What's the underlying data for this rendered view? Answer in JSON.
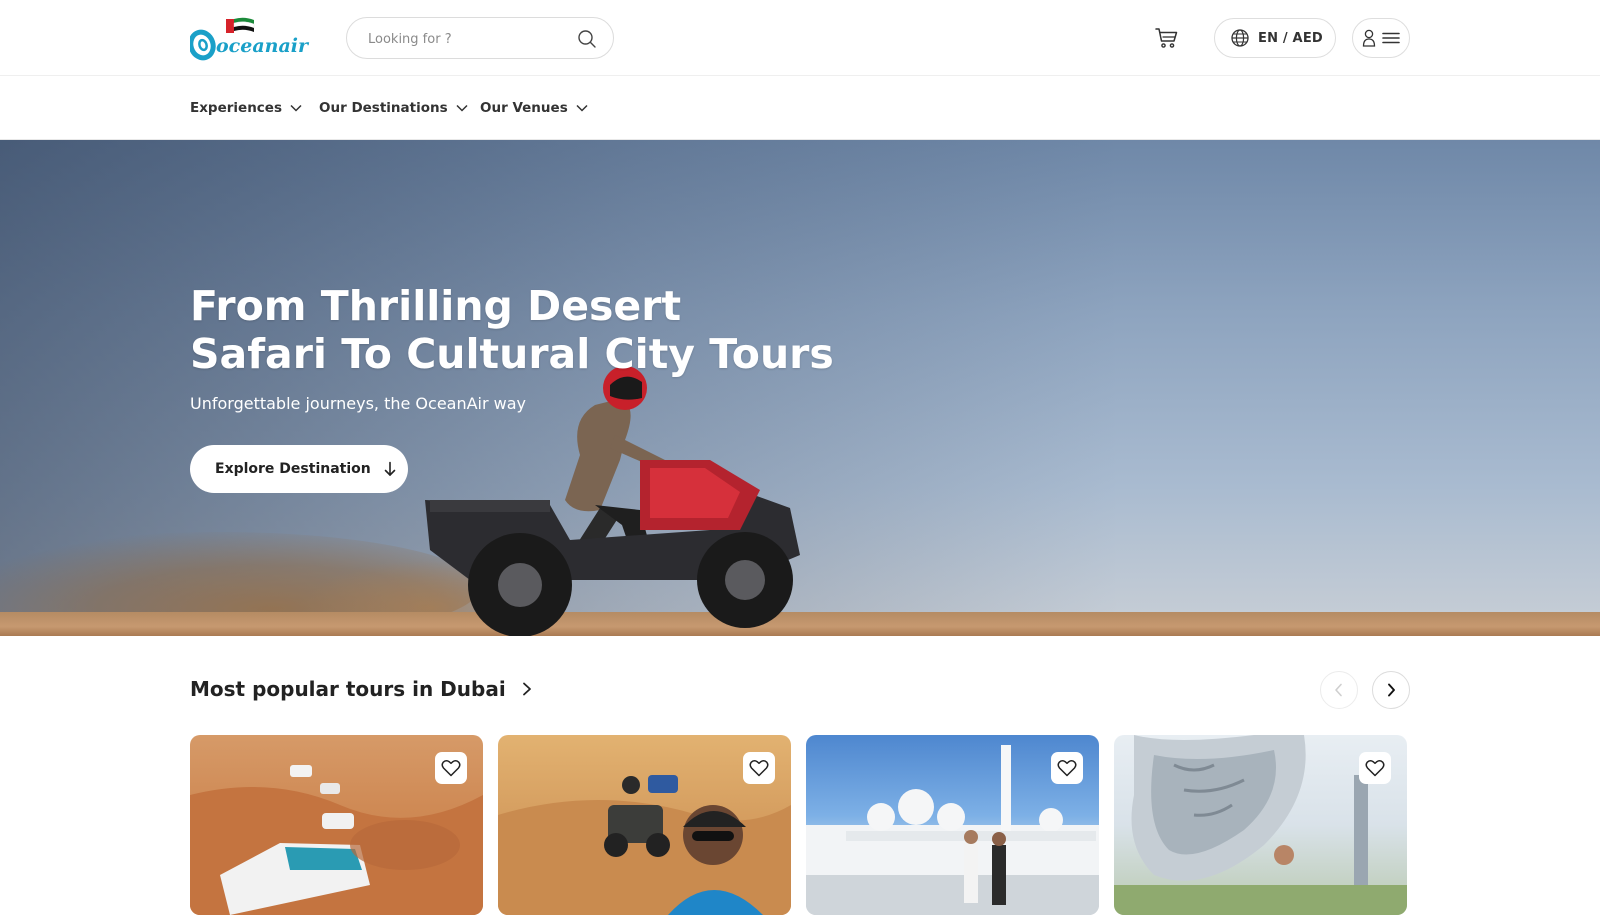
{
  "header": {
    "brand": "oceanair",
    "search_placeholder": "Looking for ?",
    "language_currency": "EN / AED"
  },
  "nav": {
    "items": [
      {
        "label": "Experiences"
      },
      {
        "label": "Our Destinations"
      },
      {
        "label": "Our Venues"
      }
    ]
  },
  "hero": {
    "title_line1": "From Thrilling Desert",
    "title_line2": "Safari To Cultural City Tours",
    "subtitle": "Unforgettable journeys, the OceanAir way",
    "cta_label": "Explore Destination"
  },
  "popular": {
    "title": "Most popular tours in Dubai",
    "cards": [
      {
        "scene": "desert-dune-bashing"
      },
      {
        "scene": "quad-bike-selfie"
      },
      {
        "scene": "grand-mosque"
      },
      {
        "scene": "museum-of-the-future"
      }
    ]
  },
  "colors": {
    "logo_blue": "#1aa0c8",
    "text_dark": "#222222",
    "border": "#dcdcdc",
    "hero_sky": "#8ea4bf",
    "sand": "#c69970"
  },
  "icons": {
    "search": "search-icon",
    "cart": "cart-icon",
    "globe": "globe-icon",
    "user": "user-icon",
    "menu": "menu-icon",
    "chevron": "chevron-down-icon",
    "arrow_down": "arrow-down-icon",
    "chevron_right": "chevron-right-icon",
    "chevron_left": "chevron-left-icon",
    "heart": "heart-icon"
  }
}
